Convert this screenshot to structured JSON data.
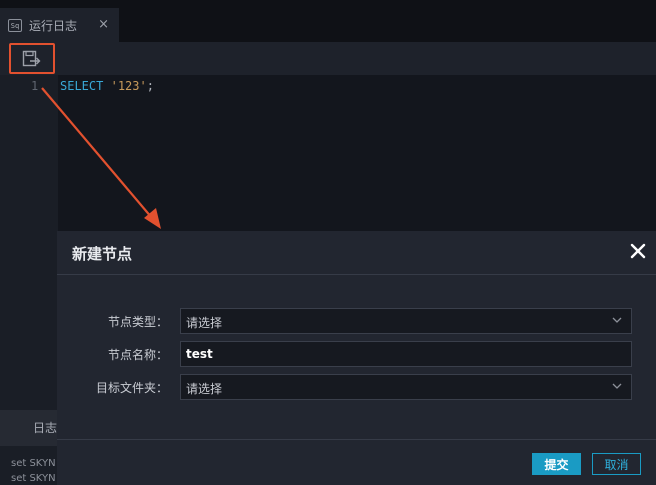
{
  "tab": {
    "icon_text": "Sq",
    "label": "运行日志",
    "close_glyph": "×"
  },
  "toolbar": {
    "save_icon": "save-to-node-icon"
  },
  "editor": {
    "line_number": "1",
    "code": {
      "keyword": "SELECT",
      "string": "'123'",
      "terminator": ";"
    }
  },
  "bottom": {
    "tab_label": "日志",
    "log_lines": [
      "set SKYN",
      "set SKYN"
    ]
  },
  "dialog": {
    "title": "新建节点",
    "close_icon": "close-icon",
    "fields": [
      {
        "label": "节点类型：",
        "value": "请选择",
        "kind": "select"
      },
      {
        "label": "节点名称：",
        "value": "test",
        "kind": "text"
      },
      {
        "label": "目标文件夹：",
        "value": "请选择",
        "kind": "select"
      }
    ],
    "submit_label": "提交",
    "cancel_label": "取消"
  },
  "colors": {
    "annotation": "#e2512f",
    "accent": "#1a9bc4",
    "background": "#13161d"
  }
}
